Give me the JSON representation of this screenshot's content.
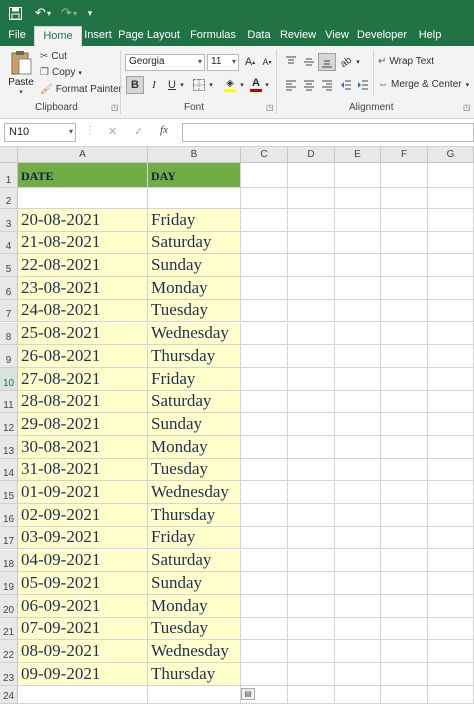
{
  "qat": {
    "save_icon": "save-icon",
    "undo_icon": "undo-icon",
    "redo_icon": "redo-icon",
    "customize_icon": "customize-qat-icon"
  },
  "tabs": [
    {
      "label": "File",
      "active": false
    },
    {
      "label": "Home",
      "active": true
    },
    {
      "label": "Insert",
      "active": false
    },
    {
      "label": "Page Layout",
      "active": false
    },
    {
      "label": "Formulas",
      "active": false
    },
    {
      "label": "Data",
      "active": false
    },
    {
      "label": "Review",
      "active": false
    },
    {
      "label": "View",
      "active": false
    },
    {
      "label": "Developer",
      "active": false
    },
    {
      "label": "Help",
      "active": false
    }
  ],
  "clipboard": {
    "paste_label": "Paste",
    "cut_label": "Cut",
    "copy_label": "Copy",
    "format_painter_label": "Format Painter",
    "group_label": "Clipboard"
  },
  "font": {
    "name": "Georgia",
    "size": "11",
    "bold": "B",
    "italic": "I",
    "underline": "U",
    "font_color_glyph": "A",
    "group_label": "Font"
  },
  "alignment": {
    "wrap_text_label": "Wrap Text",
    "merge_center_label": "Merge & Center",
    "group_label": "Alignment"
  },
  "formula_bar": {
    "name_box": "N10",
    "fx": "fx",
    "cancel": "✕",
    "enter": "✓",
    "formula": ""
  },
  "colors": {
    "excel_green": "#217346",
    "header_fill": "#70ad47",
    "data_fill": "#ffffcc"
  },
  "grid": {
    "columns": [
      "A",
      "B",
      "C",
      "D",
      "E",
      "F",
      "G"
    ],
    "row_numbers": [
      "1",
      "2",
      "3",
      "4",
      "5",
      "6",
      "7",
      "8",
      "9",
      "10",
      "11",
      "12",
      "13",
      "14",
      "15",
      "16",
      "17",
      "18",
      "19",
      "20",
      "21",
      "22",
      "23",
      "24"
    ],
    "selected_row": "10",
    "header_row": {
      "date": "DATE",
      "day": "DAY"
    },
    "rows": [
      {
        "date": "20-08-2021",
        "day": "Friday"
      },
      {
        "date": "21-08-2021",
        "day": "Saturday"
      },
      {
        "date": "22-08-2021",
        "day": "Sunday"
      },
      {
        "date": "23-08-2021",
        "day": "Monday"
      },
      {
        "date": "24-08-2021",
        "day": "Tuesday"
      },
      {
        "date": "25-08-2021",
        "day": "Wednesday"
      },
      {
        "date": "26-08-2021",
        "day": "Thursday"
      },
      {
        "date": "27-08-2021",
        "day": "Friday"
      },
      {
        "date": "28-08-2021",
        "day": "Saturday"
      },
      {
        "date": "29-08-2021",
        "day": "Sunday"
      },
      {
        "date": "30-08-2021",
        "day": "Monday"
      },
      {
        "date": "31-08-2021",
        "day": "Tuesday"
      },
      {
        "date": "01-09-2021",
        "day": "Wednesday"
      },
      {
        "date": "02-09-2021",
        "day": "Thursday"
      },
      {
        "date": "03-09-2021",
        "day": "Friday"
      },
      {
        "date": "04-09-2021",
        "day": "Saturday"
      },
      {
        "date": "05-09-2021",
        "day": "Sunday"
      },
      {
        "date": "06-09-2021",
        "day": "Monday"
      },
      {
        "date": "07-09-2021",
        "day": "Tuesday"
      },
      {
        "date": "08-09-2021",
        "day": "Wednesday"
      },
      {
        "date": "09-09-2021",
        "day": "Thursday"
      }
    ]
  }
}
